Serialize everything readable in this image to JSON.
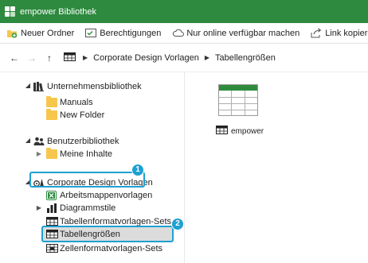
{
  "window": {
    "title": "empower Bibliothek"
  },
  "toolbar": {
    "new_folder": "Neuer Ordner",
    "permissions": "Berechtigungen",
    "online_only": "Nur online verfügbar machen",
    "copy_link": "Link kopieren"
  },
  "navigation": {
    "breadcrumb": [
      "Corporate Design Vorlagen",
      "Tabellengrößen"
    ]
  },
  "tree": {
    "company_library": "Unternehmensbibliothek",
    "manuals": "Manuals",
    "new_folder": "New Folder",
    "user_library": "Benutzerbibliothek",
    "my_content": "Meine Inhalte",
    "corporate_design": "Corporate Design Vorlagen",
    "workbook_templates": "Arbeitsmappenvorlagen",
    "chart_styles": "Diagrammstile",
    "table_format_sets": "Tabellenformatvorlagen-Sets",
    "table_sizes": "Tabellengrößen",
    "cell_format_sets": "Zellenformatvorlagen-Sets"
  },
  "content": {
    "item_name": "empower"
  },
  "callouts": [
    "1",
    "2"
  ],
  "colors": {
    "title_bar": "#2d8a3e",
    "callout": "#1ea0d2",
    "folder": "#f7c64c"
  }
}
